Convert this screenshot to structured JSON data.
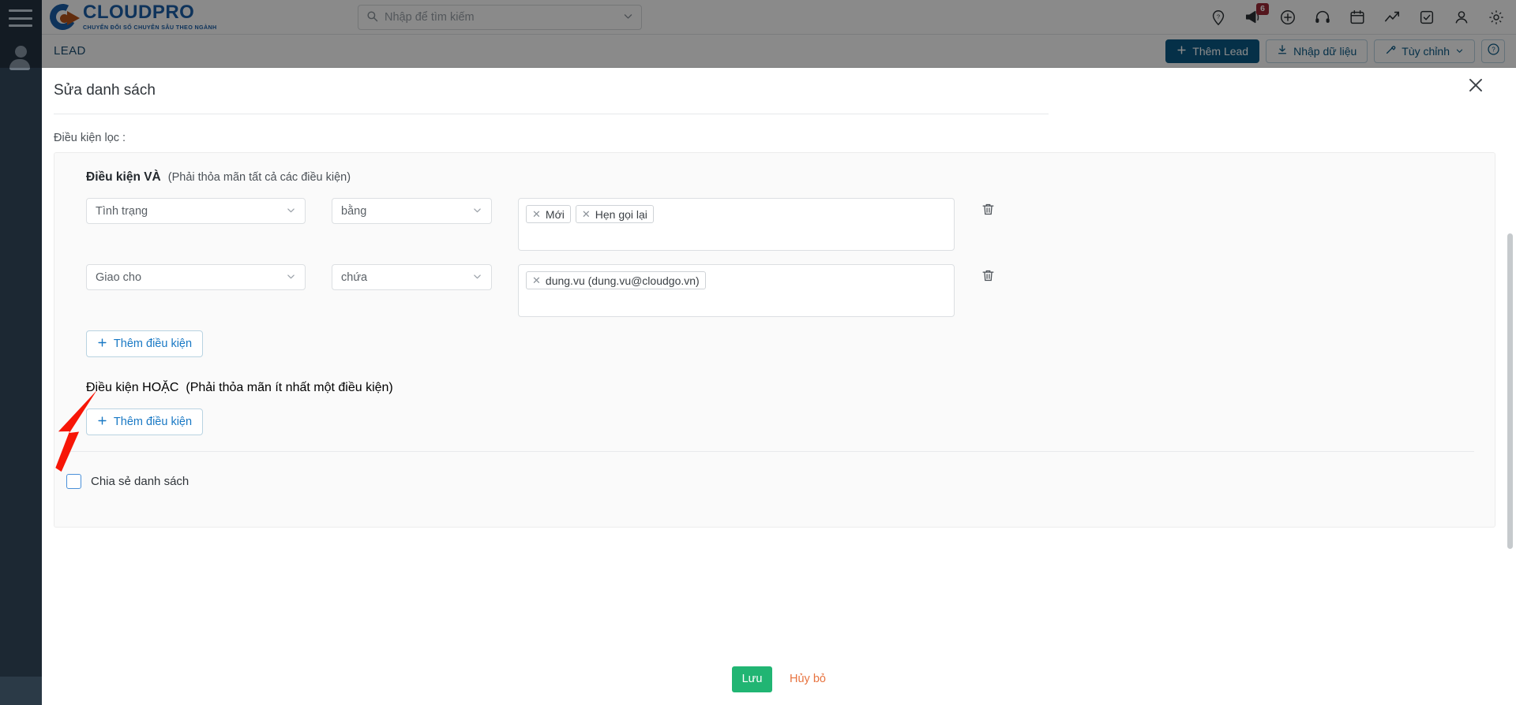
{
  "app": {
    "logo_title": "CLOUDPRO",
    "logo_subtitle": "CHUYỂN ĐỔI SỐ CHUYÊN SÂU THEO NGÀNH",
    "accent_blue": "#1a5fa8",
    "accent_orange": "#b5531a"
  },
  "search": {
    "placeholder": "Nhập để tìm kiếm",
    "icon": "search-icon",
    "caret_icon": "chevron-down-icon"
  },
  "top_icons": [
    {
      "name": "location-help-icon",
      "badge": null
    },
    {
      "name": "megaphone-icon",
      "badge": "6"
    },
    {
      "name": "plus-circle-icon",
      "badge": null
    },
    {
      "name": "support-headset-icon",
      "badge": null
    },
    {
      "name": "calendar-icon",
      "badge": null
    },
    {
      "name": "chart-icon",
      "badge": null
    },
    {
      "name": "task-check-icon",
      "badge": null
    },
    {
      "name": "user-icon",
      "badge": null
    },
    {
      "name": "gear-icon",
      "badge": null
    }
  ],
  "leadbar": {
    "title": "LEAD",
    "add_lead": "Thêm Lead",
    "import": "Nhập dữ liệu",
    "customize": "Tùy chỉnh",
    "help_icon": "question-circle-icon"
  },
  "modal": {
    "title": "Sửa danh sách",
    "close_icon": "close-icon",
    "filters_label": "Điều kiện lọc :",
    "and_group": {
      "title": "Điều kiện VÀ",
      "hint": "(Phải thỏa mãn tất cả các điều kiện)",
      "add_condition": "Thêm điều kiện",
      "rows": [
        {
          "field": "Tình trạng",
          "operator": "bằng",
          "tags": [
            "Mới",
            "Hẹn gọi lại"
          ]
        },
        {
          "field": "Giao cho",
          "operator": "chứa",
          "tags": [
            "dung.vu (dung.vu@cloudgo.vn)"
          ]
        }
      ]
    },
    "or_group": {
      "title": "Điều kiện HOẶC",
      "hint": "(Phải thỏa mãn ít nhất một điều kiện)",
      "add_condition": "Thêm điều kiện"
    },
    "share": {
      "label": "Chia sẻ danh sách",
      "checked": false
    },
    "footer": {
      "save": "Lưu",
      "cancel": "Hủy bỏ",
      "save_color": "#21b573",
      "cancel_color": "#e8733f"
    }
  }
}
